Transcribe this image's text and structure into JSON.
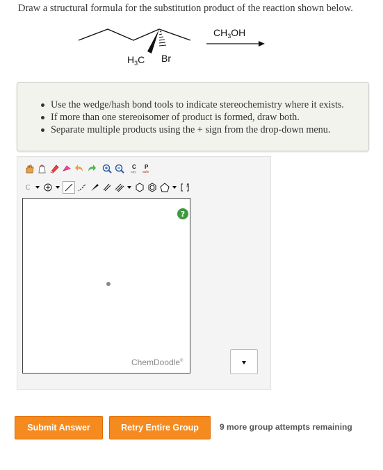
{
  "question": {
    "text": "Draw a structural formula for the substitution product of the reaction shown below."
  },
  "reaction": {
    "methyl_label": "H3C",
    "leaving_group_label": "Br",
    "reagent": "CH3OH"
  },
  "instructions": {
    "items": [
      "Use the wedge/hash bond tools to indicate stereochemistry where it exists.",
      "If more than one stereoisomer of product is formed, draw both.",
      "Separate multiple products using the + sign from the drop-down menu."
    ]
  },
  "sketcher": {
    "brand": "ChemDoodle",
    "brand_mark": "®",
    "element_selector": "C",
    "copy_label": "C\ncpy",
    "paste_label": "P\naste",
    "help_symbol": "?"
  },
  "actions": {
    "submit_label": "Submit Answer",
    "retry_label": "Retry Entire Group",
    "attempts_text": "9 more group attempts remaining"
  },
  "colors": {
    "button_orange": "#f58a1f",
    "help_green": "#3d9a3d"
  }
}
